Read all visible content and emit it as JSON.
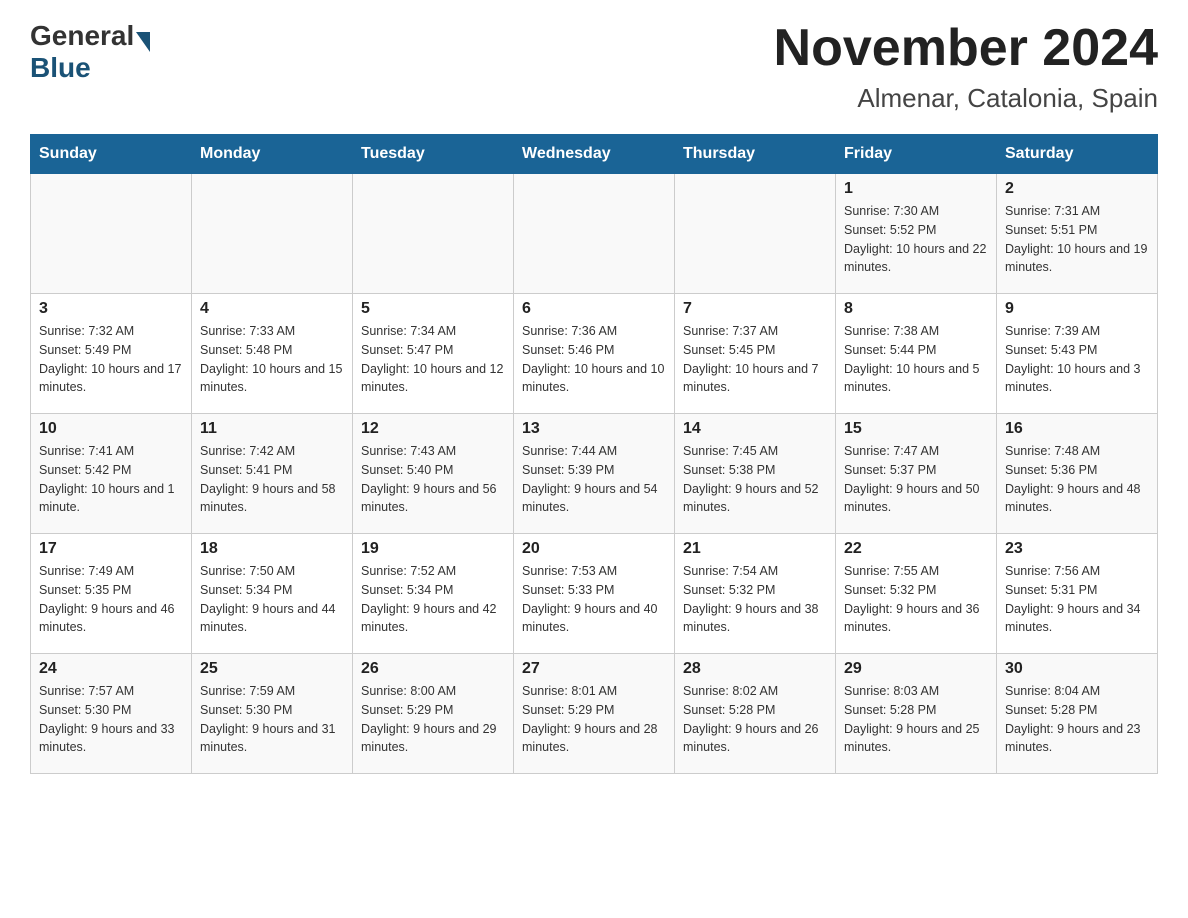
{
  "header": {
    "title": "November 2024",
    "subtitle": "Almenar, Catalonia, Spain"
  },
  "logo": {
    "general": "General",
    "blue": "Blue"
  },
  "days": [
    "Sunday",
    "Monday",
    "Tuesday",
    "Wednesday",
    "Thursday",
    "Friday",
    "Saturday"
  ],
  "weeks": [
    [
      {
        "day": "",
        "info": ""
      },
      {
        "day": "",
        "info": ""
      },
      {
        "day": "",
        "info": ""
      },
      {
        "day": "",
        "info": ""
      },
      {
        "day": "",
        "info": ""
      },
      {
        "day": "1",
        "info": "Sunrise: 7:30 AM\nSunset: 5:52 PM\nDaylight: 10 hours and 22 minutes."
      },
      {
        "day": "2",
        "info": "Sunrise: 7:31 AM\nSunset: 5:51 PM\nDaylight: 10 hours and 19 minutes."
      }
    ],
    [
      {
        "day": "3",
        "info": "Sunrise: 7:32 AM\nSunset: 5:49 PM\nDaylight: 10 hours and 17 minutes."
      },
      {
        "day": "4",
        "info": "Sunrise: 7:33 AM\nSunset: 5:48 PM\nDaylight: 10 hours and 15 minutes."
      },
      {
        "day": "5",
        "info": "Sunrise: 7:34 AM\nSunset: 5:47 PM\nDaylight: 10 hours and 12 minutes."
      },
      {
        "day": "6",
        "info": "Sunrise: 7:36 AM\nSunset: 5:46 PM\nDaylight: 10 hours and 10 minutes."
      },
      {
        "day": "7",
        "info": "Sunrise: 7:37 AM\nSunset: 5:45 PM\nDaylight: 10 hours and 7 minutes."
      },
      {
        "day": "8",
        "info": "Sunrise: 7:38 AM\nSunset: 5:44 PM\nDaylight: 10 hours and 5 minutes."
      },
      {
        "day": "9",
        "info": "Sunrise: 7:39 AM\nSunset: 5:43 PM\nDaylight: 10 hours and 3 minutes."
      }
    ],
    [
      {
        "day": "10",
        "info": "Sunrise: 7:41 AM\nSunset: 5:42 PM\nDaylight: 10 hours and 1 minute."
      },
      {
        "day": "11",
        "info": "Sunrise: 7:42 AM\nSunset: 5:41 PM\nDaylight: 9 hours and 58 minutes."
      },
      {
        "day": "12",
        "info": "Sunrise: 7:43 AM\nSunset: 5:40 PM\nDaylight: 9 hours and 56 minutes."
      },
      {
        "day": "13",
        "info": "Sunrise: 7:44 AM\nSunset: 5:39 PM\nDaylight: 9 hours and 54 minutes."
      },
      {
        "day": "14",
        "info": "Sunrise: 7:45 AM\nSunset: 5:38 PM\nDaylight: 9 hours and 52 minutes."
      },
      {
        "day": "15",
        "info": "Sunrise: 7:47 AM\nSunset: 5:37 PM\nDaylight: 9 hours and 50 minutes."
      },
      {
        "day": "16",
        "info": "Sunrise: 7:48 AM\nSunset: 5:36 PM\nDaylight: 9 hours and 48 minutes."
      }
    ],
    [
      {
        "day": "17",
        "info": "Sunrise: 7:49 AM\nSunset: 5:35 PM\nDaylight: 9 hours and 46 minutes."
      },
      {
        "day": "18",
        "info": "Sunrise: 7:50 AM\nSunset: 5:34 PM\nDaylight: 9 hours and 44 minutes."
      },
      {
        "day": "19",
        "info": "Sunrise: 7:52 AM\nSunset: 5:34 PM\nDaylight: 9 hours and 42 minutes."
      },
      {
        "day": "20",
        "info": "Sunrise: 7:53 AM\nSunset: 5:33 PM\nDaylight: 9 hours and 40 minutes."
      },
      {
        "day": "21",
        "info": "Sunrise: 7:54 AM\nSunset: 5:32 PM\nDaylight: 9 hours and 38 minutes."
      },
      {
        "day": "22",
        "info": "Sunrise: 7:55 AM\nSunset: 5:32 PM\nDaylight: 9 hours and 36 minutes."
      },
      {
        "day": "23",
        "info": "Sunrise: 7:56 AM\nSunset: 5:31 PM\nDaylight: 9 hours and 34 minutes."
      }
    ],
    [
      {
        "day": "24",
        "info": "Sunrise: 7:57 AM\nSunset: 5:30 PM\nDaylight: 9 hours and 33 minutes."
      },
      {
        "day": "25",
        "info": "Sunrise: 7:59 AM\nSunset: 5:30 PM\nDaylight: 9 hours and 31 minutes."
      },
      {
        "day": "26",
        "info": "Sunrise: 8:00 AM\nSunset: 5:29 PM\nDaylight: 9 hours and 29 minutes."
      },
      {
        "day": "27",
        "info": "Sunrise: 8:01 AM\nSunset: 5:29 PM\nDaylight: 9 hours and 28 minutes."
      },
      {
        "day": "28",
        "info": "Sunrise: 8:02 AM\nSunset: 5:28 PM\nDaylight: 9 hours and 26 minutes."
      },
      {
        "day": "29",
        "info": "Sunrise: 8:03 AM\nSunset: 5:28 PM\nDaylight: 9 hours and 25 minutes."
      },
      {
        "day": "30",
        "info": "Sunrise: 8:04 AM\nSunset: 5:28 PM\nDaylight: 9 hours and 23 minutes."
      }
    ]
  ]
}
